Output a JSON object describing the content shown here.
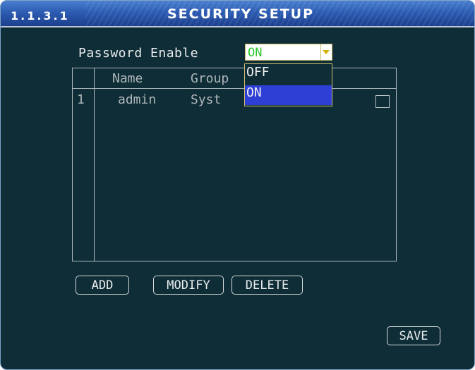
{
  "header": {
    "breadcrumb": "1.1.3.1",
    "title": "SECURITY SETUP"
  },
  "password": {
    "label": "Password Enable",
    "value": "ON",
    "options": [
      "OFF",
      "ON"
    ],
    "highlighted_option": "ON"
  },
  "table": {
    "columns": [
      "Name",
      "Group"
    ],
    "rows": [
      {
        "index": "1",
        "name": "admin",
        "group": "Syst",
        "checked": false
      }
    ]
  },
  "buttons": {
    "add": "ADD",
    "modify": "MODIFY",
    "delete": "DELETE",
    "save": "SAVE"
  },
  "colors": {
    "background": "#0f2d36",
    "titlebar": "#2c5cb2",
    "selected_option": "#2e3fd6",
    "select_value_text": "#2ec82e"
  }
}
